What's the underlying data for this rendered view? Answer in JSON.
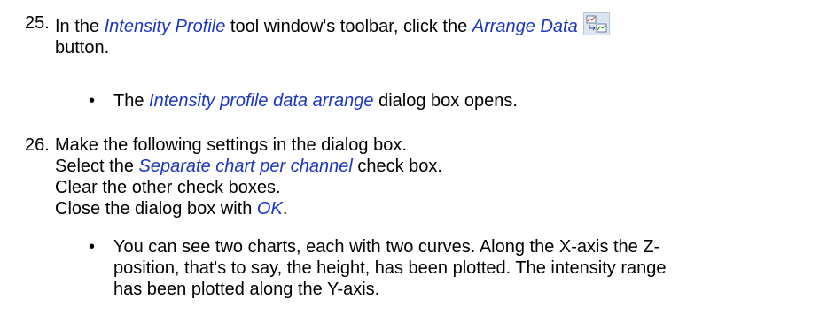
{
  "step25": {
    "number": "25.",
    "text_before": "In the ",
    "tool_name": "Intensity Profile",
    "text_middle": " tool window's toolbar, click the ",
    "button_name": "Arrange Data",
    "icon": "arrange-data-icon",
    "line2": "button.",
    "bullet": {
      "text_before": "The ",
      "dialog_name": "Intensity profile data arrange",
      "text_after": " dialog box opens."
    }
  },
  "step26": {
    "number": "26.",
    "line1": "Make the following settings in the dialog box.",
    "line2_before": "Select the ",
    "checkbox_name": "Separate chart per channel",
    "line2_after": " check box.",
    "line3": "Clear the other check boxes.",
    "line4_before": "Close the dialog box with ",
    "ok": "OK",
    "line4_after": ".",
    "bullet": {
      "line1": "You can see two charts, each with two curves. Along the X-axis the Z-",
      "line2": "position, that's to say, the height, has been plotted. The intensity range",
      "line3": "has been plotted along the Y-axis."
    }
  },
  "colors": {
    "emphasis": "#1a35c2",
    "text": "#000000"
  }
}
